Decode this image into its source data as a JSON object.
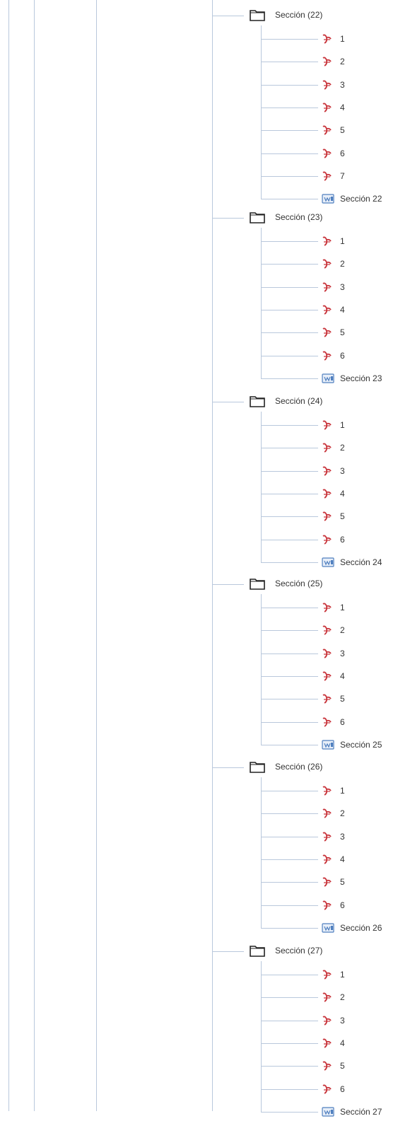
{
  "sections": [
    {
      "title": "Sección (22)",
      "items": [
        "1",
        "2",
        "3",
        "4",
        "5",
        "6",
        "7"
      ],
      "doc": "Sección 22"
    },
    {
      "title": "Sección (23)",
      "items": [
        "1",
        "2",
        "3",
        "4",
        "5",
        "6"
      ],
      "doc": "Sección 23"
    },
    {
      "title": "Sección (24)",
      "items": [
        "1",
        "2",
        "3",
        "4",
        "5",
        "6"
      ],
      "doc": "Sección 24"
    },
    {
      "title": "Sección (25)",
      "items": [
        "1",
        "2",
        "3",
        "4",
        "5",
        "6"
      ],
      "doc": "Sección 25"
    },
    {
      "title": "Sección (26)",
      "items": [
        "1",
        "2",
        "3",
        "4",
        "5",
        "6"
      ],
      "doc": "Sección 26"
    },
    {
      "title": "Sección (27)",
      "items": [
        "1",
        "2",
        "3",
        "4",
        "5",
        "6"
      ],
      "doc": "Sección 27"
    }
  ],
  "icons": {
    "folder": "folder-icon",
    "pdf": "pdf-icon",
    "doc": "word-document-icon"
  },
  "colors": {
    "connector": "#b9c8dc",
    "pdf_red": "#c8333a",
    "doc_blue": "#4f7fbf"
  }
}
